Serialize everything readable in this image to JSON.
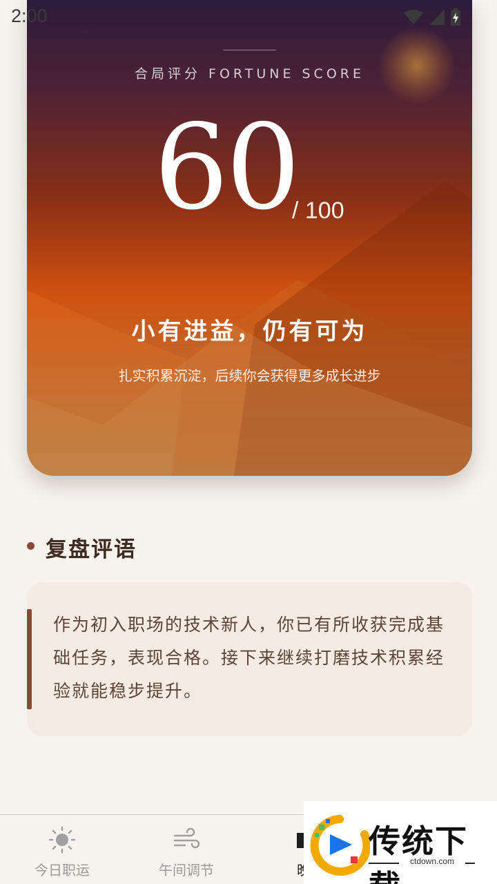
{
  "status_bar": {
    "time": "2:00",
    "icons": [
      "wifi-icon",
      "cellular-signal-icon",
      "battery-charging-icon"
    ]
  },
  "hero": {
    "label": "合局评分 FORTUNE SCORE",
    "score": "60",
    "score_max": "/ 100",
    "title": "小有进益，仍有可为",
    "subtitle": "扎实积累沉淀，后续你会获得更多成长进步"
  },
  "review": {
    "title": "复盘评语",
    "text": "作为初入职场的技术新人，你已有所收获完成基础任务，表现合格。接下来继续打磨技术积累经验就能稳步提升。"
  },
  "bottom_nav": {
    "items": [
      {
        "label": "今日职运",
        "icon": "sun-icon",
        "active": false
      },
      {
        "label": "午间调节",
        "icon": "wind-icon",
        "active": false
      },
      {
        "label": "晚间",
        "icon": "moon-icon",
        "active": true
      }
    ]
  },
  "watermark": {
    "text": "传统下载",
    "domain": "ctdown.com"
  },
  "colors": {
    "accent": "#8b4a36",
    "background": "#f6f3ef",
    "card_bg": "#f5ebe3",
    "hero_orange": "#d1520f",
    "hero_purple": "#2c1b3b"
  }
}
